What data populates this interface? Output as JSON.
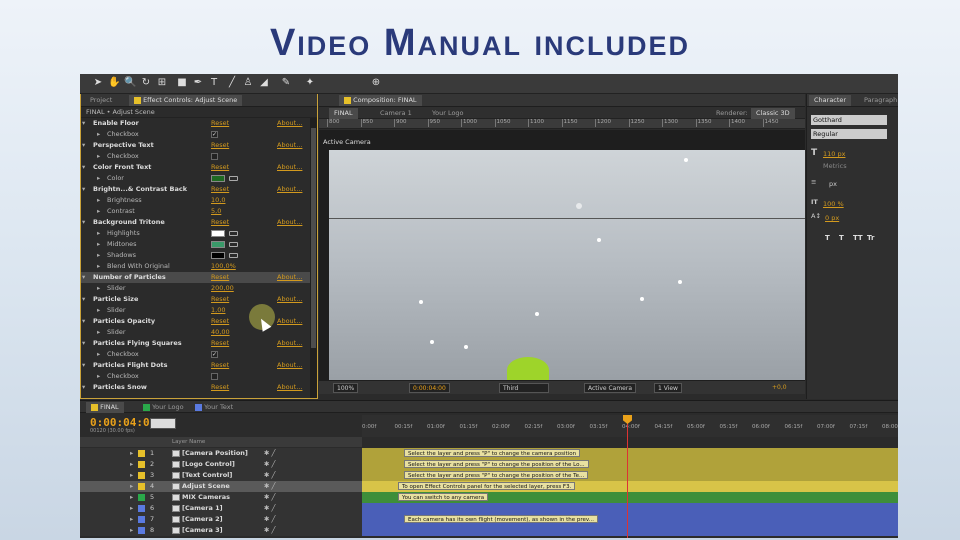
{
  "banner": {
    "title": "Video Manual included"
  },
  "effect_controls": {
    "tabs": {
      "project": "Project",
      "effect": "Effect Controls: Adjust Scene"
    },
    "subtitle": "FINAL • Adjust Scene",
    "reset": "Reset",
    "about": "About...",
    "rows": [
      {
        "kind": "eff",
        "name": "Enable Floor"
      },
      {
        "kind": "prop",
        "name": "Checkbox",
        "ctl": "check",
        "checked": true
      },
      {
        "kind": "eff",
        "name": "Perspective Text"
      },
      {
        "kind": "prop",
        "name": "Checkbox",
        "ctl": "check",
        "checked": false
      },
      {
        "kind": "eff",
        "name": "Color Front Text"
      },
      {
        "kind": "prop",
        "name": "Color",
        "ctl": "swatch",
        "color": "#1f6a22"
      },
      {
        "kind": "eff",
        "name": "Brightn...& Contrast Back"
      },
      {
        "kind": "prop",
        "name": "Brightness",
        "ctl": "value",
        "value": "10,0"
      },
      {
        "kind": "prop",
        "name": "Contrast",
        "ctl": "value",
        "value": "5,0"
      },
      {
        "kind": "eff",
        "name": "Background Tritone"
      },
      {
        "kind": "prop",
        "name": "Highlights",
        "ctl": "swatch",
        "color": "#ffffff"
      },
      {
        "kind": "prop",
        "name": "Midtones",
        "ctl": "swatch",
        "color": "#3a9a6a"
      },
      {
        "kind": "prop",
        "name": "Shadows",
        "ctl": "swatch",
        "color": "#000000"
      },
      {
        "kind": "prop",
        "name": "Blend With Original",
        "ctl": "value",
        "value": "100,0%"
      },
      {
        "kind": "eff",
        "name": "Number of Particles",
        "hl": true
      },
      {
        "kind": "prop",
        "name": "Slider",
        "ctl": "value",
        "value": "200,00"
      },
      {
        "kind": "eff",
        "name": "Particle Size"
      },
      {
        "kind": "prop",
        "name": "Slider",
        "ctl": "value",
        "value": "1,00"
      },
      {
        "kind": "eff",
        "name": "Particles Opacity"
      },
      {
        "kind": "prop",
        "name": "Slider",
        "ctl": "value",
        "value": "40,00"
      },
      {
        "kind": "eff",
        "name": "Particles Flying Squares"
      },
      {
        "kind": "prop",
        "name": "Checkbox",
        "ctl": "check",
        "checked": true
      },
      {
        "kind": "eff",
        "name": "Particles Flight Dots"
      },
      {
        "kind": "prop",
        "name": "Checkbox",
        "ctl": "check",
        "checked": false
      },
      {
        "kind": "eff",
        "name": "Particles Snow"
      }
    ]
  },
  "composition": {
    "tab": "Composition: FINAL",
    "bar": {
      "final": "FINAL",
      "camera": "Camera 1",
      "logo": "Your Logo",
      "renderer_label": "Renderer:",
      "renderer": "Classic 3D"
    },
    "ruler": [
      "800",
      "850",
      "900",
      "950",
      "1000",
      "1050",
      "1100",
      "1150",
      "1200",
      "1250",
      "1300",
      "1350",
      "1400",
      "1450"
    ],
    "view_label": "Active Camera",
    "footer": {
      "zoom": "100%",
      "time": "0:00:04:00",
      "res": "Third",
      "view": "Active Camera",
      "views": "1 View",
      "exposure": "+0,0"
    }
  },
  "character": {
    "tabs": {
      "character": "Character",
      "paragraph": "Paragraph"
    },
    "font": "Gotthard",
    "style": "Regular",
    "size": "110 px",
    "tracking": "100 %",
    "baseline": "0 px",
    "metrics": "Metrics",
    "leading_unit": "px",
    "styles": [
      "T",
      "T",
      "TT",
      "Tr"
    ]
  },
  "timeline": {
    "tabs": [
      "FINAL",
      "Your Logo",
      "Your Text"
    ],
    "tab_colors": [
      "#e6c02a",
      "#2aa84a",
      "#5a7ae0"
    ],
    "time": "0:00:04:00",
    "fps": "00120 (30.00 fps)",
    "header": {
      "layer_name": "Layer Name"
    },
    "ticks": [
      "0:00f",
      "00:15f",
      "01:00f",
      "01:15f",
      "02:00f",
      "02:15f",
      "03:00f",
      "03:15f",
      "04:00f",
      "04:15f",
      "05:00f",
      "05:15f",
      "06:00f",
      "06:15f",
      "07:00f",
      "07:15f",
      "08:00"
    ],
    "layers": [
      {
        "num": "1",
        "name": "[Camera Position]",
        "color": "#e6c02a",
        "bar": "#b0a23a",
        "note": "Select the layer and press \"P\" to change the camera position"
      },
      {
        "num": "2",
        "name": "[Logo Control]",
        "color": "#e6c02a",
        "bar": "#b0a23a",
        "note": "Select the layer and press \"P\" to change the position of the Lo..."
      },
      {
        "num": "3",
        "name": "[Text Control]",
        "color": "#e6c02a",
        "bar": "#b0a23a",
        "note": "Select the layer and press \"P\" to change the position of the Te..."
      },
      {
        "num": "4",
        "name": "Adjust Scene",
        "color": "#e6c02a",
        "bar": "#d8c448",
        "note": "To open Effect Controls panel for the selected layer, press F3.",
        "sel": true
      },
      {
        "num": "5",
        "name": "MIX Cameras",
        "color": "#2aa84a",
        "bar": "#3e8e3a",
        "note": "You can switch to any camera"
      },
      {
        "num": "6",
        "name": "[Camera 1]",
        "color": "#5a7ae0",
        "bar": "#4a5fb8",
        "note": ""
      },
      {
        "num": "7",
        "name": "[Camera 2]",
        "color": "#5a7ae0",
        "bar": "#4a5fb8",
        "note": "Each camera has its own flight (movement), as shown in the prev..."
      },
      {
        "num": "8",
        "name": "[Camera 3]",
        "color": "#5a7ae0",
        "bar": "#4a5fb8",
        "note": ""
      }
    ]
  }
}
